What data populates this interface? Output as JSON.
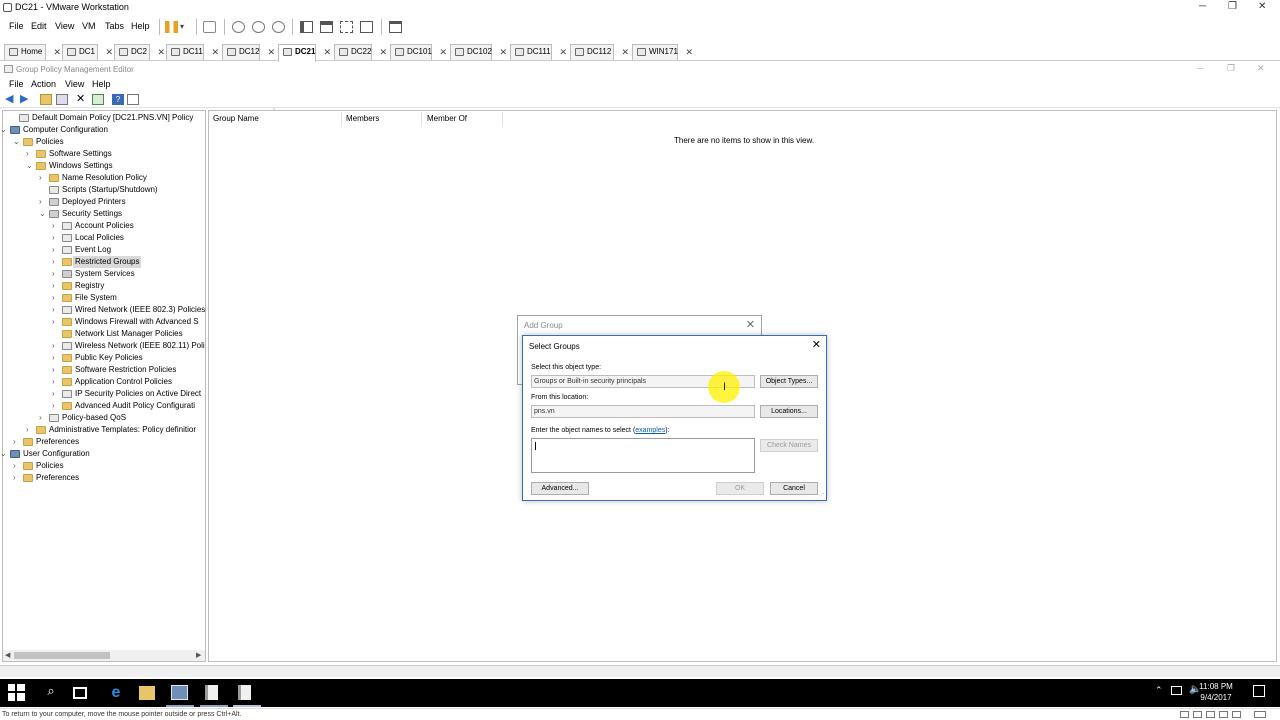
{
  "vmware": {
    "title": "DC21 - VMware Workstation",
    "menu": [
      "File",
      "Edit",
      "View",
      "VM",
      "Tabs",
      "Help"
    ],
    "tabs": [
      "Home",
      "DC1",
      "DC2",
      "DC11",
      "DC12",
      "DC21",
      "DC22",
      "DC101",
      "DC102",
      "DC111",
      "DC112",
      "WIN171"
    ],
    "active_tab": "DC21",
    "status_text": "To return to your computer, move the mouse pointer outside or press Ctrl+Alt."
  },
  "gpme": {
    "title": "Group Policy Management Editor",
    "menu": [
      "File",
      "Action",
      "View",
      "Help"
    ],
    "tree": [
      {
        "label": "Default Domain Policy [DC21.PNS.VN] Policy",
        "icon": "doc-icon"
      },
      {
        "label": "Computer Configuration",
        "icon": "computer-icon"
      },
      {
        "label": "Policies",
        "icon": "folder-icon"
      },
      {
        "label": "Software Settings",
        "icon": "folder-icon"
      },
      {
        "label": "Windows Settings",
        "icon": "folder-icon"
      },
      {
        "label": "Name Resolution Policy",
        "icon": "folder-icon"
      },
      {
        "label": "Scripts (Startup/Shutdown)",
        "icon": "doc-icon"
      },
      {
        "label": "Deployed Printers",
        "icon": "printer-icon"
      },
      {
        "label": "Security Settings",
        "icon": "security-icon"
      },
      {
        "label": "Account Policies",
        "icon": "policy-icon"
      },
      {
        "label": "Local Policies",
        "icon": "policy-icon"
      },
      {
        "label": "Event Log",
        "icon": "policy-icon"
      },
      {
        "label": "Restricted Groups",
        "icon": "folder-icon"
      },
      {
        "label": "System Services",
        "icon": "gear-icon"
      },
      {
        "label": "Registry",
        "icon": "folder-icon"
      },
      {
        "label": "File System",
        "icon": "folder-icon"
      },
      {
        "label": "Wired Network (IEEE 802.3) Policies",
        "icon": "policy-icon"
      },
      {
        "label": "Windows Firewall with Advanced S",
        "icon": "folder-icon"
      },
      {
        "label": "Network List Manager Policies",
        "icon": "folder-icon"
      },
      {
        "label": "Wireless Network (IEEE 802.11) Poli",
        "icon": "policy-icon"
      },
      {
        "label": "Public Key Policies",
        "icon": "folder-icon"
      },
      {
        "label": "Software Restriction Policies",
        "icon": "folder-icon"
      },
      {
        "label": "Application Control Policies",
        "icon": "folder-icon"
      },
      {
        "label": "IP Security Policies on Active Direct",
        "icon": "policy-icon"
      },
      {
        "label": "Advanced Audit Policy Configurati",
        "icon": "folder-icon"
      },
      {
        "label": "Policy-based QoS",
        "icon": "chart-icon"
      },
      {
        "label": "Administrative Templates: Policy definitior",
        "icon": "folder-icon"
      },
      {
        "label": "Preferences",
        "icon": "folder-icon"
      },
      {
        "label": "User Configuration",
        "icon": "user-icon"
      },
      {
        "label": "Policies",
        "icon": "folder-icon"
      },
      {
        "label": "Preferences",
        "icon": "folder-icon"
      }
    ],
    "selected_node": "Restricted Groups",
    "columns": [
      "Group Name",
      "Members",
      "Member Of"
    ],
    "empty_message": "There are no items to show in this view."
  },
  "add_group": {
    "title": "Add Group"
  },
  "select_groups": {
    "title": "Select Groups",
    "object_type_label": "Select this object type:",
    "object_type_value": "Groups or Built-in security principals",
    "object_types_button": "Object Types...",
    "location_label": "From this location:",
    "location_value": "pns.vn",
    "locations_button": "Locations...",
    "names_label": "Enter the object names to select (",
    "names_link": "examples",
    "names_label_end": "):",
    "names_value": "",
    "check_names_button": "Check Names",
    "advanced_button": "Advanced...",
    "ok_button": "OK",
    "cancel_button": "Cancel"
  },
  "taskbar": {
    "time": "11:08 PM",
    "date": "9/4/2017"
  }
}
